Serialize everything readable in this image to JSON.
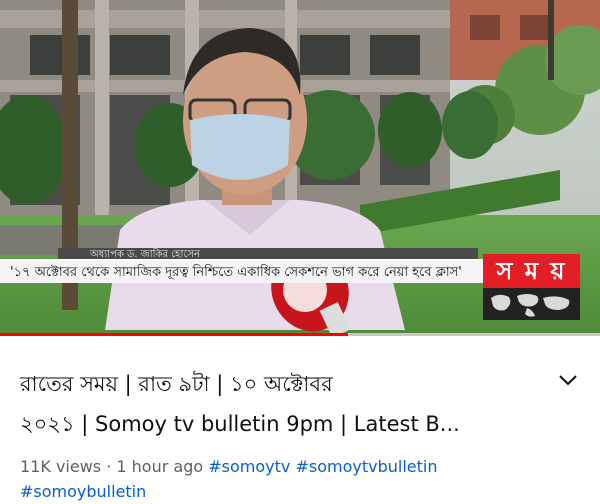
{
  "video": {
    "ticker_text": "'১৭ অক্টোবর থেকে সামাজিক দূরত্ব নিশ্চিতে একাধিক সেকশনে ভাগ করে নেয়া হবে ক্লাস'",
    "name_text": "অধ্যাপক ড. জাকির হোসেন",
    "channel_logo_text": "স ম য়",
    "progress": 0.58
  },
  "title": {
    "line1": "রাতের সময় | রাত ৯টা | ১০ অক্টোবর",
    "line2": "২০২১ | Somoy tv bulletin 9pm | Latest B..."
  },
  "meta": {
    "views": "11K views",
    "separator": " · ",
    "time_ago": "1 hour ago",
    "hashtags": [
      "#somoytv",
      "#somoytvbulletin",
      "#somoybulletin"
    ]
  },
  "icons": {
    "expand": "chevron-down-icon"
  },
  "colors": {
    "progress": "#ff0000",
    "hashtag": "#065fd4",
    "brand": "#e41e26"
  }
}
